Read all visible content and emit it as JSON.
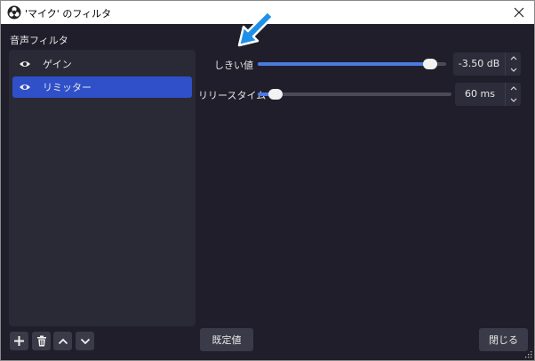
{
  "window": {
    "title": "'マイク' のフィルタ"
  },
  "filters": {
    "section_label": "音声フィルタ",
    "items": [
      {
        "label": "ゲイン",
        "selected": false
      },
      {
        "label": "リミッター",
        "selected": true
      }
    ]
  },
  "params": {
    "threshold": {
      "label": "しきい値",
      "value": "-3.50 dB",
      "level_fraction": 0.93
    },
    "release": {
      "label": "リリースタイム",
      "value": "60 ms",
      "level_fraction": 0.06
    }
  },
  "buttons": {
    "defaults": "既定値",
    "close": "閉じる"
  },
  "colors": {
    "accent": "#2f50c8",
    "slider_fill": "#4a7be0",
    "background": "#1f1e2a",
    "panel": "#2a2a36",
    "arrow": "#1e90e8"
  },
  "icons": {
    "app": "obs-icon",
    "close": "close-icon",
    "eye": "eye-icon",
    "add": "plus-icon",
    "delete": "trash-icon",
    "up": "chevron-up-icon",
    "down": "chevron-down-icon",
    "pointer": "arrow-pointer-icon"
  }
}
